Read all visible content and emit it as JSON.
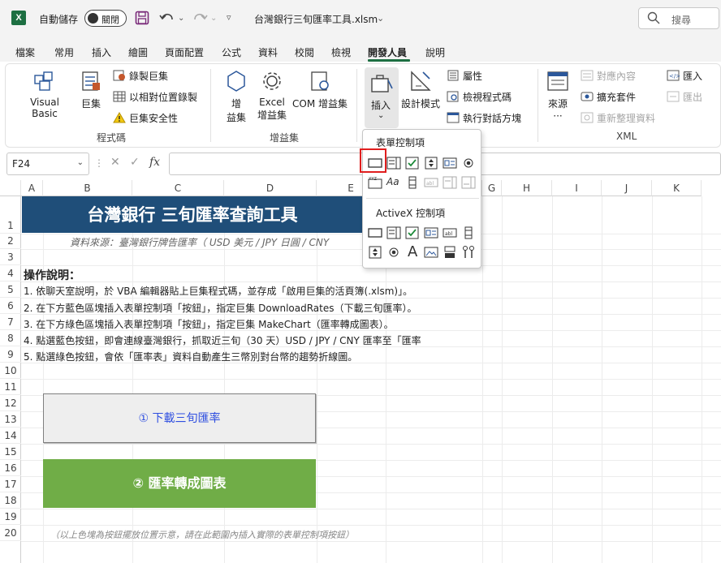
{
  "app": {
    "autosave_label": "自動儲存",
    "autosave_state": "關閉",
    "doc_title": "台灣銀行三旬匯率工具.xlsm",
    "search_placeholder": "搜尋",
    "logo_letter": "X"
  },
  "tabs": [
    {
      "label": "檔案"
    },
    {
      "label": "常用"
    },
    {
      "label": "插入"
    },
    {
      "label": "繪圖"
    },
    {
      "label": "頁面配置"
    },
    {
      "label": "公式"
    },
    {
      "label": "資料"
    },
    {
      "label": "校閱"
    },
    {
      "label": "檢視"
    },
    {
      "label": "開發人員"
    },
    {
      "label": "說明"
    }
  ],
  "ribbon": {
    "code_group": {
      "label": "程式碼",
      "visual_basic": "Visual Basic",
      "macros": "巨集",
      "record_macro": "錄製巨集",
      "relative_ref": "以相對位置錄製",
      "macro_security": "巨集安全性"
    },
    "addins_group": {
      "label": "增益集",
      "addins": "增\n益集",
      "addins_line1": "增",
      "addins_line2": "益集",
      "excel_addins_line1": "Excel",
      "excel_addins_line2": "增益集",
      "com_addins": "COM 增益集"
    },
    "controls_group": {
      "insert": "插入",
      "design_mode": "設計模式",
      "properties": "屬性",
      "view_code": "檢視程式碼",
      "run_dialog": "執行對話方塊"
    },
    "xml_group": {
      "label": "XML",
      "source": "來源",
      "source_more": "···",
      "map_properties": "對應內容",
      "expansion_packs": "擴充套件",
      "refresh_data": "重新整理資料",
      "import": "匯入",
      "export": "匯出"
    }
  },
  "formula_bar": {
    "name_box": "F24",
    "fx": "fx",
    "value": ""
  },
  "columns": [
    "A",
    "B",
    "C",
    "D",
    "E",
    "F",
    "G",
    "H",
    "I",
    "J",
    "K"
  ],
  "rows": [
    "1",
    "2",
    "3",
    "4",
    "5",
    "6",
    "7",
    "8",
    "9",
    "10",
    "11",
    "12",
    "13",
    "14",
    "15",
    "16",
    "17",
    "18",
    "19",
    "20"
  ],
  "sheet": {
    "banner_title": "台灣銀行 三旬匯率查詢工具",
    "subtitle": "資料來源：臺灣銀行牌告匯率（ USD 美元 / JPY 日圓 / CNY",
    "instructions_title": "操作說明：",
    "instructions": [
      "1. 依聊天室說明，於 VBA 編輯器貼上巨集程式碼，並存成「啟用巨集的活頁簿(.xlsm)」。",
      "2. 在下方藍色區塊插入表單控制項「按鈕」，指定巨集 DownloadRates（下載三旬匯率）。",
      "3. 在下方綠色區塊插入表單控制項「按鈕」，指定巨集 MakeChart（匯率轉成圖表）。",
      "4. 點選藍色按鈕，即會連線臺灣銀行，抓取近三旬（30 天）USD / JPY / CNY 匯率至「匯率",
      "5. 點選綠色按鈕，會依「匯率表」資料自動產生三幣別對台幣的趨勢折線圖。"
    ],
    "btn_download": "① 下載三旬匯率",
    "btn_chart": "② 匯率轉成圖表",
    "note": "（以上色塊為按鈕擺放位置示意，請在此範圍內插入實際的表單控制項按鈕）"
  },
  "dropdown": {
    "form_controls_title": "表單控制項",
    "activex_title": "ActiveX 控制項",
    "label_glyph": "Aa",
    "label_xyz": "XYZ",
    "text_glyph": "A"
  },
  "colors": {
    "banner": "#1f4e79",
    "green_button": "#70ad47",
    "excel_green": "#1d6f42",
    "highlight": "#e01e1e"
  }
}
